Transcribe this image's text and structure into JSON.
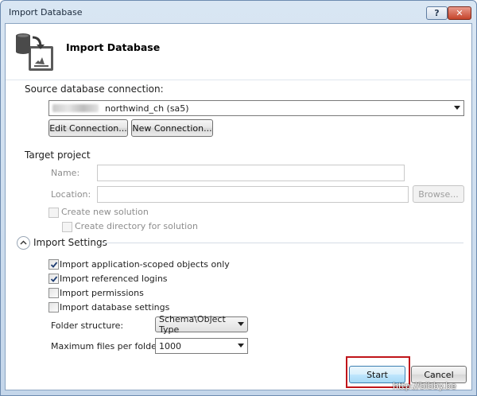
{
  "window": {
    "title": "Import Database",
    "help_label": "?",
    "close_label": "✕"
  },
  "header": {
    "title": "Import Database"
  },
  "source": {
    "label": "Source database connection:",
    "connection_value": "northwind_ch (sa5)",
    "edit_connection_label": "Edit Connection...",
    "new_connection_label": "New Connection..."
  },
  "target": {
    "label": "Target project",
    "name_label": "Name:",
    "name_value": "",
    "location_label": "Location:",
    "location_value": "",
    "browse_label": "Browse...",
    "create_solution_label": "Create new solution",
    "create_directory_label": "Create directory for solution"
  },
  "import_settings": {
    "label": "Import Settings",
    "options": [
      {
        "label": "Import application-scoped objects only",
        "checked": true
      },
      {
        "label": "Import referenced logins",
        "checked": true
      },
      {
        "label": "Import permissions",
        "checked": false
      },
      {
        "label": "Import database settings",
        "checked": false
      }
    ],
    "folder_structure_label": "Folder structure:",
    "folder_structure_value": "Schema\\Object Type",
    "max_files_label": "Maximum files per folder:",
    "max_files_value": "1000"
  },
  "footer": {
    "start_label": "Start",
    "cancel_label": "Cancel"
  },
  "watermark": "http://bibby.be",
  "colors": {
    "title_bar": "#c4d6ea",
    "highlight_border": "#c0151a",
    "checkbox_check": "#1f3e73"
  }
}
